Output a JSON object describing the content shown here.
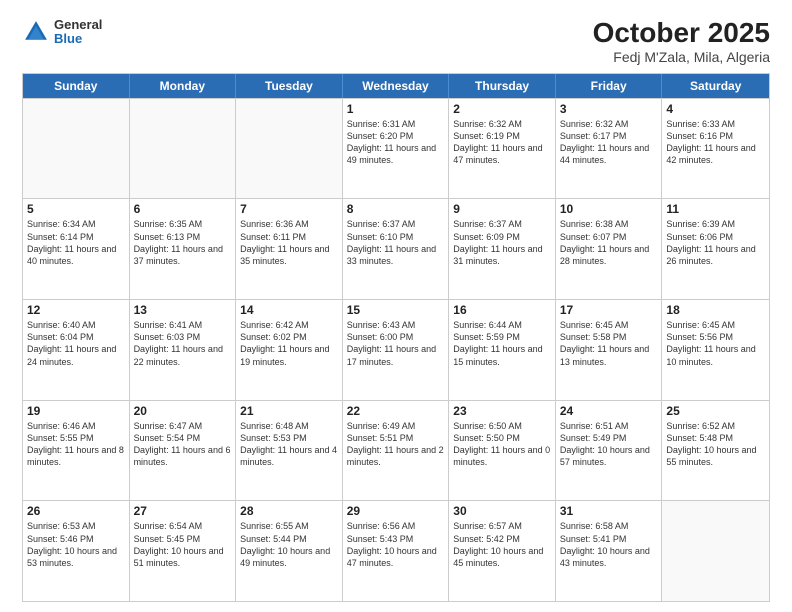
{
  "logo": {
    "general": "General",
    "blue": "Blue"
  },
  "title": {
    "month": "October 2025",
    "location": "Fedj M'Zala, Mila, Algeria"
  },
  "header_days": [
    "Sunday",
    "Monday",
    "Tuesday",
    "Wednesday",
    "Thursday",
    "Friday",
    "Saturday"
  ],
  "rows": [
    [
      {
        "day": "",
        "sunrise": "",
        "sunset": "",
        "daylight": "",
        "empty": true
      },
      {
        "day": "",
        "sunrise": "",
        "sunset": "",
        "daylight": "",
        "empty": true
      },
      {
        "day": "",
        "sunrise": "",
        "sunset": "",
        "daylight": "",
        "empty": true
      },
      {
        "day": "1",
        "sunrise": "Sunrise: 6:31 AM",
        "sunset": "Sunset: 6:20 PM",
        "daylight": "Daylight: 11 hours and 49 minutes.",
        "empty": false
      },
      {
        "day": "2",
        "sunrise": "Sunrise: 6:32 AM",
        "sunset": "Sunset: 6:19 PM",
        "daylight": "Daylight: 11 hours and 47 minutes.",
        "empty": false
      },
      {
        "day": "3",
        "sunrise": "Sunrise: 6:32 AM",
        "sunset": "Sunset: 6:17 PM",
        "daylight": "Daylight: 11 hours and 44 minutes.",
        "empty": false
      },
      {
        "day": "4",
        "sunrise": "Sunrise: 6:33 AM",
        "sunset": "Sunset: 6:16 PM",
        "daylight": "Daylight: 11 hours and 42 minutes.",
        "empty": false
      }
    ],
    [
      {
        "day": "5",
        "sunrise": "Sunrise: 6:34 AM",
        "sunset": "Sunset: 6:14 PM",
        "daylight": "Daylight: 11 hours and 40 minutes.",
        "empty": false
      },
      {
        "day": "6",
        "sunrise": "Sunrise: 6:35 AM",
        "sunset": "Sunset: 6:13 PM",
        "daylight": "Daylight: 11 hours and 37 minutes.",
        "empty": false
      },
      {
        "day": "7",
        "sunrise": "Sunrise: 6:36 AM",
        "sunset": "Sunset: 6:11 PM",
        "daylight": "Daylight: 11 hours and 35 minutes.",
        "empty": false
      },
      {
        "day": "8",
        "sunrise": "Sunrise: 6:37 AM",
        "sunset": "Sunset: 6:10 PM",
        "daylight": "Daylight: 11 hours and 33 minutes.",
        "empty": false
      },
      {
        "day": "9",
        "sunrise": "Sunrise: 6:37 AM",
        "sunset": "Sunset: 6:09 PM",
        "daylight": "Daylight: 11 hours and 31 minutes.",
        "empty": false
      },
      {
        "day": "10",
        "sunrise": "Sunrise: 6:38 AM",
        "sunset": "Sunset: 6:07 PM",
        "daylight": "Daylight: 11 hours and 28 minutes.",
        "empty": false
      },
      {
        "day": "11",
        "sunrise": "Sunrise: 6:39 AM",
        "sunset": "Sunset: 6:06 PM",
        "daylight": "Daylight: 11 hours and 26 minutes.",
        "empty": false
      }
    ],
    [
      {
        "day": "12",
        "sunrise": "Sunrise: 6:40 AM",
        "sunset": "Sunset: 6:04 PM",
        "daylight": "Daylight: 11 hours and 24 minutes.",
        "empty": false
      },
      {
        "day": "13",
        "sunrise": "Sunrise: 6:41 AM",
        "sunset": "Sunset: 6:03 PM",
        "daylight": "Daylight: 11 hours and 22 minutes.",
        "empty": false
      },
      {
        "day": "14",
        "sunrise": "Sunrise: 6:42 AM",
        "sunset": "Sunset: 6:02 PM",
        "daylight": "Daylight: 11 hours and 19 minutes.",
        "empty": false
      },
      {
        "day": "15",
        "sunrise": "Sunrise: 6:43 AM",
        "sunset": "Sunset: 6:00 PM",
        "daylight": "Daylight: 11 hours and 17 minutes.",
        "empty": false
      },
      {
        "day": "16",
        "sunrise": "Sunrise: 6:44 AM",
        "sunset": "Sunset: 5:59 PM",
        "daylight": "Daylight: 11 hours and 15 minutes.",
        "empty": false
      },
      {
        "day": "17",
        "sunrise": "Sunrise: 6:45 AM",
        "sunset": "Sunset: 5:58 PM",
        "daylight": "Daylight: 11 hours and 13 minutes.",
        "empty": false
      },
      {
        "day": "18",
        "sunrise": "Sunrise: 6:45 AM",
        "sunset": "Sunset: 5:56 PM",
        "daylight": "Daylight: 11 hours and 10 minutes.",
        "empty": false
      }
    ],
    [
      {
        "day": "19",
        "sunrise": "Sunrise: 6:46 AM",
        "sunset": "Sunset: 5:55 PM",
        "daylight": "Daylight: 11 hours and 8 minutes.",
        "empty": false
      },
      {
        "day": "20",
        "sunrise": "Sunrise: 6:47 AM",
        "sunset": "Sunset: 5:54 PM",
        "daylight": "Daylight: 11 hours and 6 minutes.",
        "empty": false
      },
      {
        "day": "21",
        "sunrise": "Sunrise: 6:48 AM",
        "sunset": "Sunset: 5:53 PM",
        "daylight": "Daylight: 11 hours and 4 minutes.",
        "empty": false
      },
      {
        "day": "22",
        "sunrise": "Sunrise: 6:49 AM",
        "sunset": "Sunset: 5:51 PM",
        "daylight": "Daylight: 11 hours and 2 minutes.",
        "empty": false
      },
      {
        "day": "23",
        "sunrise": "Sunrise: 6:50 AM",
        "sunset": "Sunset: 5:50 PM",
        "daylight": "Daylight: 11 hours and 0 minutes.",
        "empty": false
      },
      {
        "day": "24",
        "sunrise": "Sunrise: 6:51 AM",
        "sunset": "Sunset: 5:49 PM",
        "daylight": "Daylight: 10 hours and 57 minutes.",
        "empty": false
      },
      {
        "day": "25",
        "sunrise": "Sunrise: 6:52 AM",
        "sunset": "Sunset: 5:48 PM",
        "daylight": "Daylight: 10 hours and 55 minutes.",
        "empty": false
      }
    ],
    [
      {
        "day": "26",
        "sunrise": "Sunrise: 6:53 AM",
        "sunset": "Sunset: 5:46 PM",
        "daylight": "Daylight: 10 hours and 53 minutes.",
        "empty": false
      },
      {
        "day": "27",
        "sunrise": "Sunrise: 6:54 AM",
        "sunset": "Sunset: 5:45 PM",
        "daylight": "Daylight: 10 hours and 51 minutes.",
        "empty": false
      },
      {
        "day": "28",
        "sunrise": "Sunrise: 6:55 AM",
        "sunset": "Sunset: 5:44 PM",
        "daylight": "Daylight: 10 hours and 49 minutes.",
        "empty": false
      },
      {
        "day": "29",
        "sunrise": "Sunrise: 6:56 AM",
        "sunset": "Sunset: 5:43 PM",
        "daylight": "Daylight: 10 hours and 47 minutes.",
        "empty": false
      },
      {
        "day": "30",
        "sunrise": "Sunrise: 6:57 AM",
        "sunset": "Sunset: 5:42 PM",
        "daylight": "Daylight: 10 hours and 45 minutes.",
        "empty": false
      },
      {
        "day": "31",
        "sunrise": "Sunrise: 6:58 AM",
        "sunset": "Sunset: 5:41 PM",
        "daylight": "Daylight: 10 hours and 43 minutes.",
        "empty": false
      },
      {
        "day": "",
        "sunrise": "",
        "sunset": "",
        "daylight": "",
        "empty": true
      }
    ]
  ]
}
